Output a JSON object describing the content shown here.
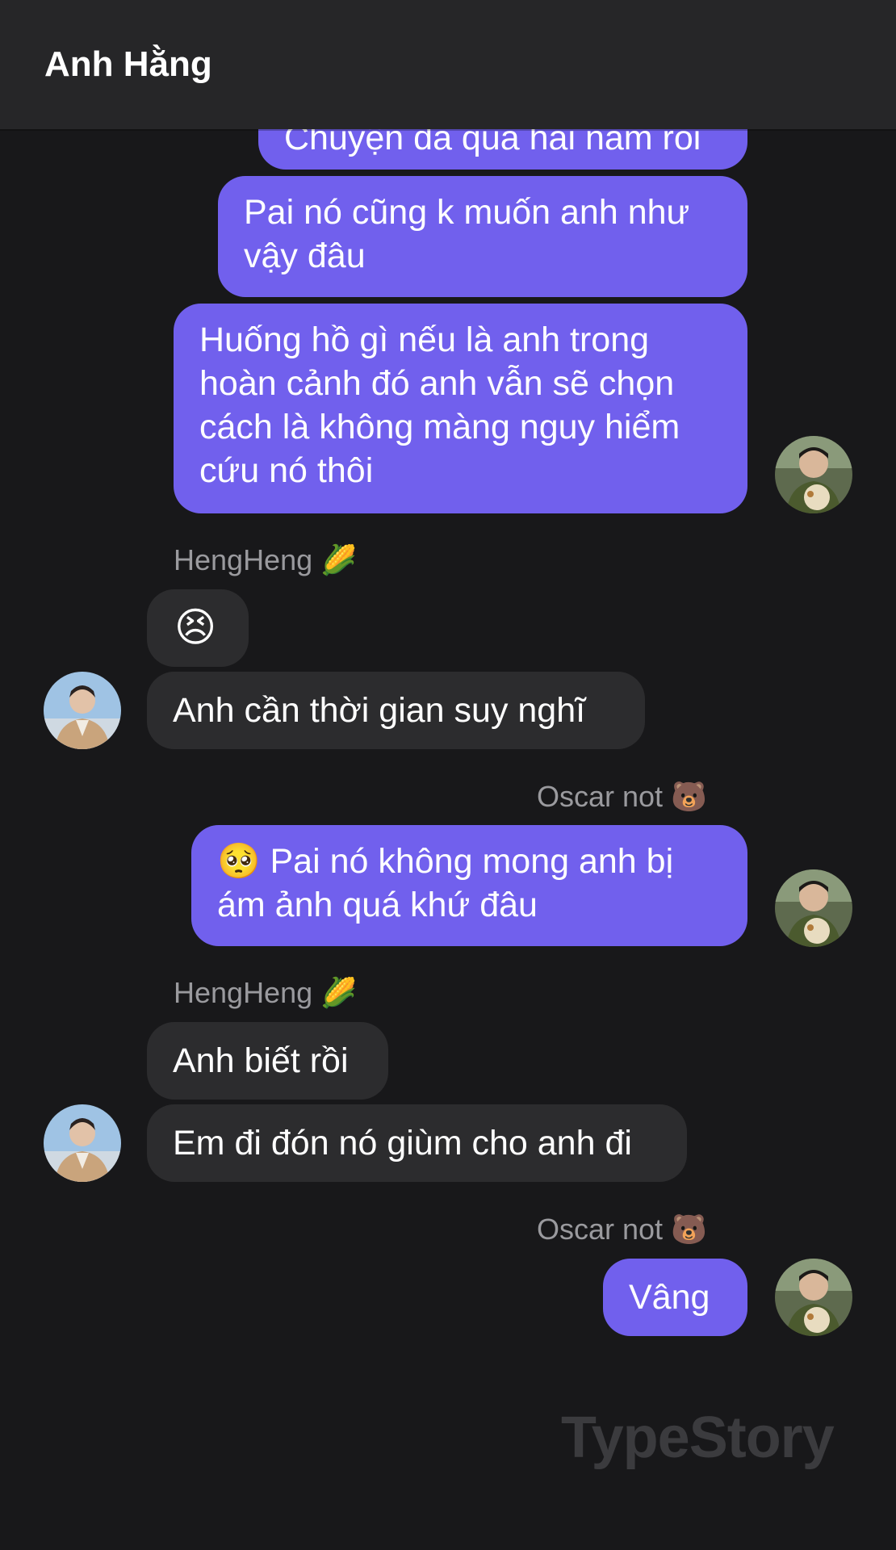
{
  "header": {
    "title": "Anh Hằng"
  },
  "messages": {
    "m0": "Chuyện đã quá hai năm rồi",
    "m1": "Pai nó cũng k muốn anh như vậy đâu",
    "m2": "Huống hồ gì nếu là anh trong hoàn cảnh đó anh vẫn sẽ chọn cách là không màng nguy hiểm cứu nó thôi",
    "m3": "😣",
    "m4": "Anh cần thời gian suy nghĩ",
    "m5": "🥺 Pai nó không mong anh  bị ám ảnh quá khứ đâu",
    "m6": "Anh biết rồi",
    "m7": "Em đi đón nó giùm cho anh đi",
    "m8": "Vâng"
  },
  "senders": {
    "heng": "HengHeng 🌽",
    "oscar": "Oscar not 🐻"
  },
  "watermark": "TypeStory",
  "colors": {
    "outgoing": "#7160ed",
    "incoming": "#2c2c2e",
    "background": "#18181a"
  }
}
